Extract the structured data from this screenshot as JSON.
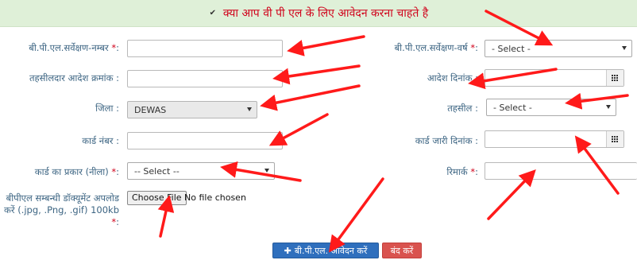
{
  "banner": {
    "checkbox_mark": "✔",
    "title": "क्या आप वी पी एल के लिए आवेदन करना चाहते है"
  },
  "form": {
    "bpl_survey_no": {
      "label": "बी.पी.एल.सर्वेक्षण-नम्बर",
      "req": "*",
      "colon": ":"
    },
    "bpl_survey_year": {
      "label": "बी.पी.एल.सर्वेक्षण-वर्ष",
      "req": "*",
      "colon": ":",
      "value": "- Select -"
    },
    "tehsildar_order_no": {
      "label": "तहसीलदार आदेश क्रमांक :"
    },
    "order_date": {
      "label": "आदेश दिनांक :"
    },
    "district": {
      "label": "जिला :",
      "value": "DEWAS"
    },
    "tehsil": {
      "label": "तहसील :",
      "value": "- Select -"
    },
    "card_no": {
      "label": "कार्ड नंबर :"
    },
    "card_issue_date": {
      "label": "कार्ड जारी दिनांक :"
    },
    "card_type": {
      "label": "कार्ड का प्रकार (नीला)",
      "req": "*",
      "colon": ":",
      "value": "-- Select --"
    },
    "remark": {
      "label": "रिमार्क",
      "req": "*",
      "colon": ":"
    },
    "bpl_doc": {
      "label_line1": "बीपीएल सम्बन्धी डॉक्यूमेंट अपलोड",
      "label_line2": "करें (.jpg, .Png, .gif) 100kb",
      "req": "*",
      "colon": ":",
      "button": "Choose File",
      "status": "No file chosen"
    }
  },
  "actions": {
    "submit_icon": "✚",
    "submit": "बी.पी.एल. आवेदन करें",
    "close": "बंद करें"
  },
  "colors": {
    "accent_red": "#d0021b",
    "banner_bg": "#dff0d8",
    "submit_bg": "#2f6fbd",
    "close_bg": "#d9534f",
    "arrow": "#ff1a1a"
  }
}
